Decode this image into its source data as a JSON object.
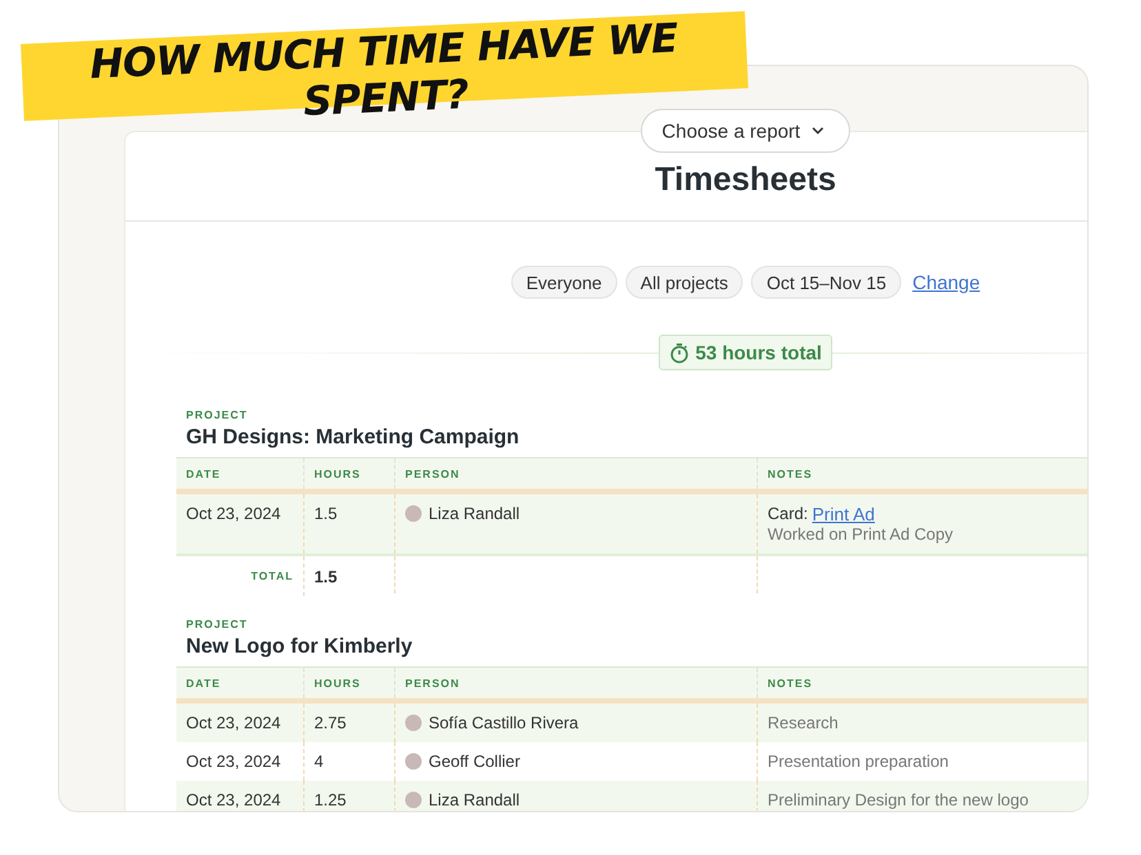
{
  "banner": {
    "text": "HOW MUCH TIME HAVE WE SPENT?"
  },
  "report_menu": {
    "label": "Choose a report"
  },
  "title": "Timesheets",
  "filters": [
    {
      "label": "Everyone"
    },
    {
      "label": "All projects"
    },
    {
      "label": "Oct 15–Nov 15"
    }
  ],
  "change_link": "Change",
  "total_badge": "53 hours total",
  "projects": [
    {
      "label": "PROJECT",
      "name": "GH Designs: Marketing Campaign",
      "columns": [
        "DATE",
        "HOURS",
        "PERSON",
        "NOTES"
      ],
      "rows": [
        {
          "date": "Oct 23, 2024",
          "hours": "1.5",
          "person": "Liza Randall",
          "notes": {
            "card_label": "Card:",
            "card_link": "Print Ad",
            "text": "Worked on Print Ad Copy"
          }
        }
      ],
      "total": {
        "label": "TOTAL",
        "value": "1.5"
      }
    },
    {
      "label": "PROJECT",
      "name": "New Logo for Kimberly",
      "columns": [
        "DATE",
        "HOURS",
        "PERSON",
        "NOTES"
      ],
      "rows": [
        {
          "date": "Oct 23, 2024",
          "hours": "2.75",
          "person": "Sofía Castillo Rivera",
          "notes": {
            "text": "Research"
          }
        },
        {
          "date": "Oct 23, 2024",
          "hours": "4",
          "person": "Geoff Collier",
          "notes": {
            "text": "Presentation preparation"
          }
        },
        {
          "date": "Oct 23, 2024",
          "hours": "1.25",
          "person": "Liza Randall",
          "notes": {
            "text": "Preliminary Design for the new logo"
          }
        }
      ]
    }
  ]
}
